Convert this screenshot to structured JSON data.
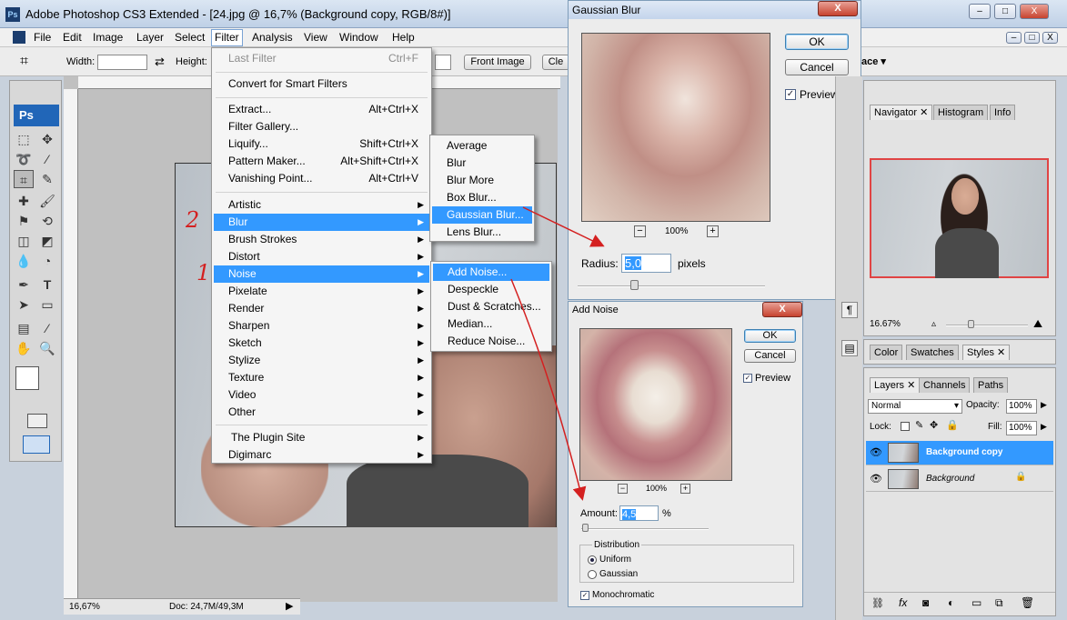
{
  "app": {
    "title": "Adobe Photoshop CS3 Extended - [24.jpg @ 16,7% (Background copy, RGB/8#)]",
    "icon": "photoshop-icon",
    "win_min": "–",
    "win_max": "□",
    "win_close": "X",
    "doc_min": "–",
    "doc_max": "□",
    "doc_close": "X"
  },
  "menubar": [
    "File",
    "Edit",
    "Image",
    "Layer",
    "Select",
    "Filter",
    "Analysis",
    "View",
    "Window",
    "Help"
  ],
  "options": {
    "width_label": "Width:",
    "height_label": "Height:",
    "front_image": "Front Image",
    "clear": "Cle",
    "workspace_partial": "ace ▾"
  },
  "toolbox": {
    "logo": "Ps"
  },
  "filter_menu": {
    "last_filter": {
      "label": "Last Filter",
      "shortcut": "Ctrl+F"
    },
    "convert": "Convert for Smart Filters",
    "extract": {
      "label": "Extract...",
      "shortcut": "Alt+Ctrl+X"
    },
    "gallery": "Filter Gallery...",
    "liquify": {
      "label": "Liquify...",
      "shortcut": "Shift+Ctrl+X"
    },
    "pattern": {
      "label": "Pattern Maker...",
      "shortcut": "Alt+Shift+Ctrl+X"
    },
    "vanishing": {
      "label": "Vanishing Point...",
      "shortcut": "Alt+Ctrl+V"
    },
    "groups": [
      "Artistic",
      "Blur",
      "Brush Strokes",
      "Distort",
      "Noise",
      "Pixelate",
      "Render",
      "Sharpen",
      "Sketch",
      "Stylize",
      "Texture",
      "Video",
      "Other"
    ],
    "plugins": [
      "The Plugin Site",
      "Digimarc"
    ]
  },
  "blur_submenu": [
    "Average",
    "Blur",
    "Blur More",
    "Box Blur...",
    "Gaussian Blur...",
    "Lens Blur..."
  ],
  "noise_submenu": [
    "Add Noise...",
    "Despeckle",
    "Dust & Scratches...",
    "Median...",
    "Reduce Noise..."
  ],
  "annotations": {
    "one": "1",
    "two": "2"
  },
  "gaussian": {
    "title": "Gaussian Blur",
    "close": "X",
    "ok": "OK",
    "cancel": "Cancel",
    "preview": "Preview",
    "preview_checked": true,
    "zoom": "100%",
    "zoom_out": "−",
    "zoom_in": "+",
    "radius_label": "Radius:",
    "radius_value": "5,0",
    "radius_unit": "pixels"
  },
  "add_noise": {
    "title": "Add Noise",
    "close": "X",
    "ok": "OK",
    "cancel": "Cancel",
    "preview": "Preview",
    "preview_checked": true,
    "zoom": "100%",
    "zoom_out": "−",
    "zoom_in": "+",
    "amount_label": "Amount:",
    "amount_value": "4,5",
    "amount_unit": "%",
    "distribution_label": "Distribution",
    "uniform": "Uniform",
    "gaussian": "Gaussian",
    "selected": "Uniform",
    "monochromatic": "Monochromatic",
    "monochromatic_checked": true
  },
  "status": {
    "zoom": "16,67%",
    "doc": "Doc: 24,7M/49,3M"
  },
  "navigator": {
    "tabs": [
      "Navigator",
      "Histogram",
      "Info"
    ],
    "zoom": "16.67%"
  },
  "color_tabs": [
    "Color",
    "Swatches",
    "Styles"
  ],
  "layers": {
    "tabs": [
      "Layers",
      "Channels",
      "Paths"
    ],
    "blend": "Normal",
    "opacity_label": "Opacity:",
    "opacity": "100%",
    "lock_label": "Lock:",
    "fill_label": "Fill:",
    "fill": "100%",
    "items": [
      {
        "name": "Background copy",
        "selected": true
      },
      {
        "name": "Background",
        "selected": false,
        "locked": true
      }
    ]
  },
  "colors": {
    "accent": "#3399ff",
    "annotation": "#d42020"
  }
}
